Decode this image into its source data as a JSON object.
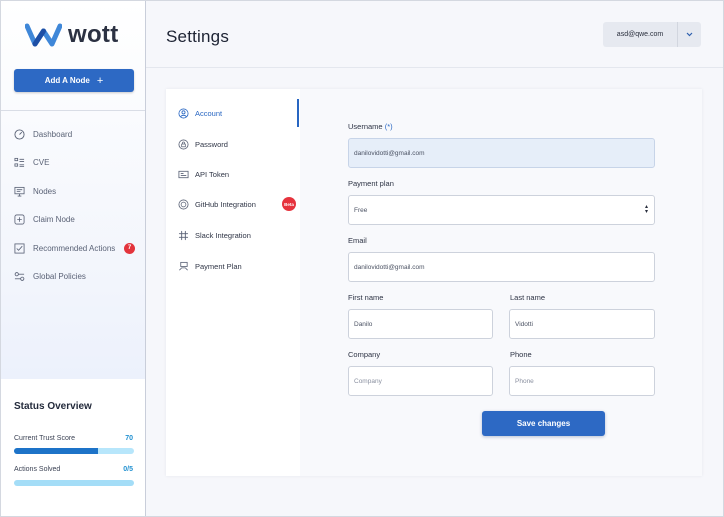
{
  "app": {
    "logo_text": "wott"
  },
  "sidebar": {
    "add_node_label": "Add A Node",
    "items": [
      {
        "label": "Dashboard",
        "icon": "gauge-icon"
      },
      {
        "label": "CVE",
        "icon": "list-icon"
      },
      {
        "label": "Nodes",
        "icon": "monitor-icon"
      },
      {
        "label": "Claim Node",
        "icon": "plus-square-icon"
      },
      {
        "label": "Recommended Actions",
        "icon": "checkbox-icon",
        "badge": "7"
      },
      {
        "label": "Global Policies",
        "icon": "toggles-icon"
      }
    ]
  },
  "status": {
    "title": "Status Overview",
    "trust_label": "Current Trust Score",
    "trust_value": "70",
    "trust_fraction": 0.7,
    "actions_label": "Actions Solved",
    "actions_value": "0/5",
    "actions_fraction": 0
  },
  "header": {
    "title": "Settings",
    "user_email": "asd@qwe.com"
  },
  "tabs": [
    {
      "label": "Account",
      "icon": "user-circle-icon",
      "active": true
    },
    {
      "label": "Password",
      "icon": "lock-circle-icon"
    },
    {
      "label": "API Token",
      "icon": "token-icon"
    },
    {
      "label": "GitHub Integration",
      "icon": "github-icon",
      "badge": "Beta"
    },
    {
      "label": "Slack Integration",
      "icon": "slack-icon"
    },
    {
      "label": "Payment Plan",
      "icon": "payment-icon"
    }
  ],
  "form": {
    "username_label": "Username",
    "required_mark": "(*)",
    "username_value": "danilovidotti@gmail.com",
    "payment_plan_label": "Payment plan",
    "payment_plan_value": "Free",
    "email_label": "Email",
    "email_value": "danilovidotti@gmail.com",
    "first_name_label": "First name",
    "first_name_value": "Danilo",
    "last_name_label": "Last name",
    "last_name_value": "Vidotti",
    "company_label": "Company",
    "company_placeholder": "Company",
    "phone_label": "Phone",
    "phone_placeholder": "Phone",
    "save_label": "Save changes"
  },
  "colors": {
    "accent": "#2d69c4",
    "badge": "#e3343c",
    "score": "#1e8fd0"
  }
}
